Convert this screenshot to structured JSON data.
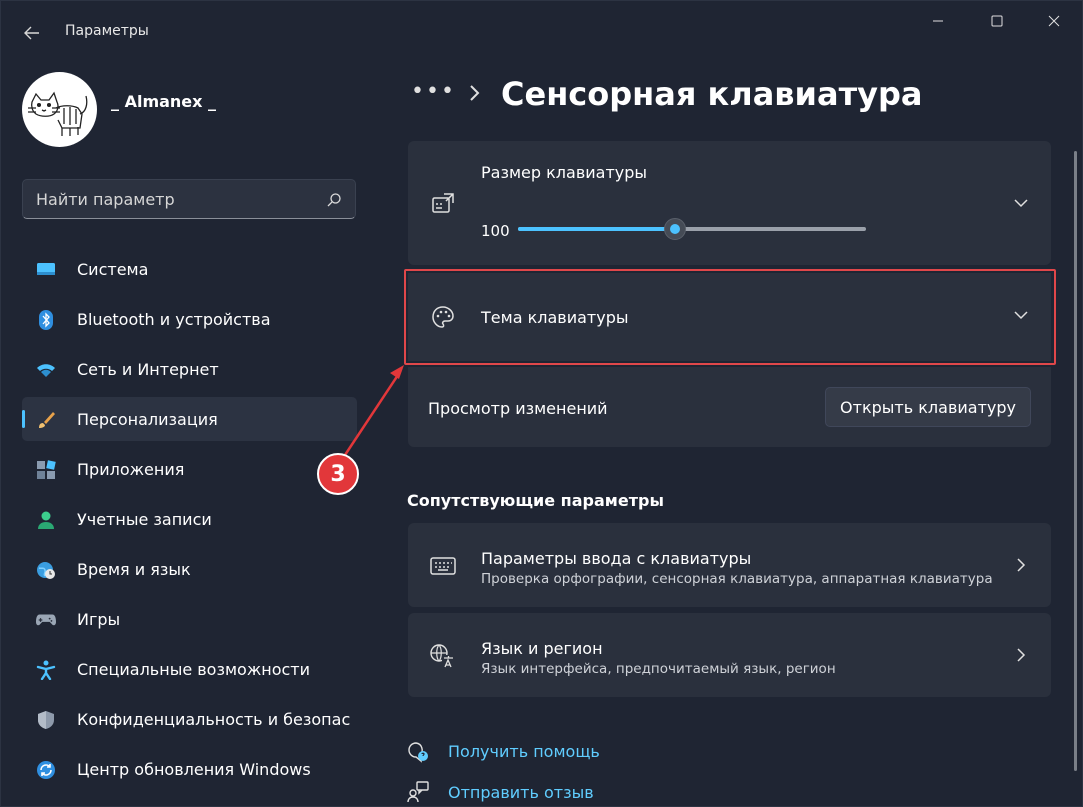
{
  "window": {
    "title": "Параметры",
    "controls": [
      "minimize-icon",
      "maximize-icon",
      "close-icon"
    ]
  },
  "profile": {
    "name": "_ Almanex _"
  },
  "search": {
    "placeholder": "Найти параметр"
  },
  "sidebar": {
    "items": [
      {
        "label": "Система",
        "icon": "system-icon"
      },
      {
        "label": "Bluetooth и устройства",
        "icon": "bluetooth-icon"
      },
      {
        "label": "Сеть и Интернет",
        "icon": "wifi-icon"
      },
      {
        "label": "Персонализация",
        "icon": "brush-icon",
        "active": true
      },
      {
        "label": "Приложения",
        "icon": "apps-icon"
      },
      {
        "label": "Учетные записи",
        "icon": "account-icon"
      },
      {
        "label": "Время и язык",
        "icon": "globe-clock-icon"
      },
      {
        "label": "Игры",
        "icon": "gamepad-icon"
      },
      {
        "label": "Специальные возможности",
        "icon": "accessibility-icon"
      },
      {
        "label": "Конфиденциальность и безопас",
        "icon": "shield-icon"
      },
      {
        "label": "Центр обновления Windows",
        "icon": "update-icon"
      }
    ]
  },
  "breadcrumb": {
    "dots": "•••",
    "page_title": "Сенсорная клавиатура"
  },
  "keyboard_size": {
    "title": "Размер клавиатуры",
    "value": "100",
    "level": 0.45
  },
  "keyboard_theme": {
    "title": "Тема клавиатуры"
  },
  "preview": {
    "label": "Просмотр изменений",
    "button": "Открыть клавиатуру"
  },
  "related": {
    "title": "Сопутствующие параметры",
    "items": [
      {
        "title": "Параметры ввода с клавиатуры",
        "subtitle": "Проверка орфографии, сенсорная клавиатура, аппаратная клавиатура",
        "icon": "keyboard-icon"
      },
      {
        "title": "Язык и регион",
        "subtitle": "Язык интерфейса, предпочитаемый язык, регион",
        "icon": "language-icon"
      }
    ]
  },
  "links": {
    "help": "Получить помощь",
    "feedback": "Отправить отзыв"
  },
  "annotation": {
    "step": "3"
  },
  "colors": {
    "accent": "#4cc2ff",
    "link": "#60cdff",
    "highlight": "#e0474a",
    "background": "#1f2533",
    "card": "#2a303d"
  }
}
